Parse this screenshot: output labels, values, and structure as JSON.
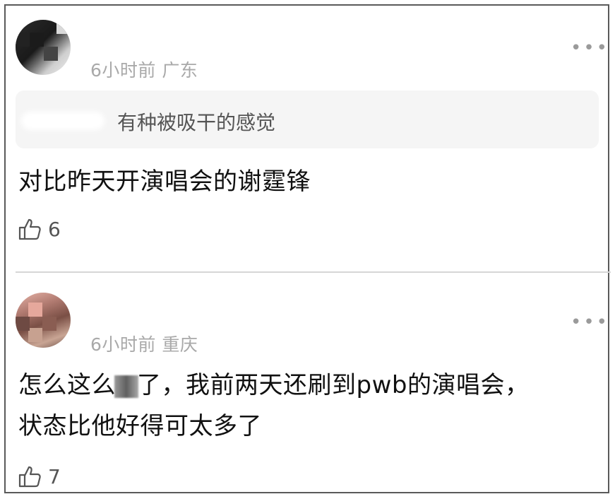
{
  "comments": [
    {
      "meta": "6小时前 广东",
      "more": "•••",
      "quote": {
        "text": "有种被吸干的感觉"
      },
      "content_lines": [
        "对比昨天开演唱会的谢霆锋"
      ],
      "likes": "6"
    },
    {
      "meta": "6小时前 重庆",
      "more": "•••",
      "content_line1_before": "怎么这么",
      "content_line1_after": "了，我前两天还刷到pwb的演唱会，",
      "content_line2": "状态比他好得可太多了",
      "likes": "7"
    }
  ],
  "colors": {
    "meta": "#a9a9a9",
    "quote_bg": "#f5f5f5",
    "text": "#111111"
  },
  "icons": {
    "like": "thumbs-up-icon",
    "more": "more-dots-icon"
  }
}
